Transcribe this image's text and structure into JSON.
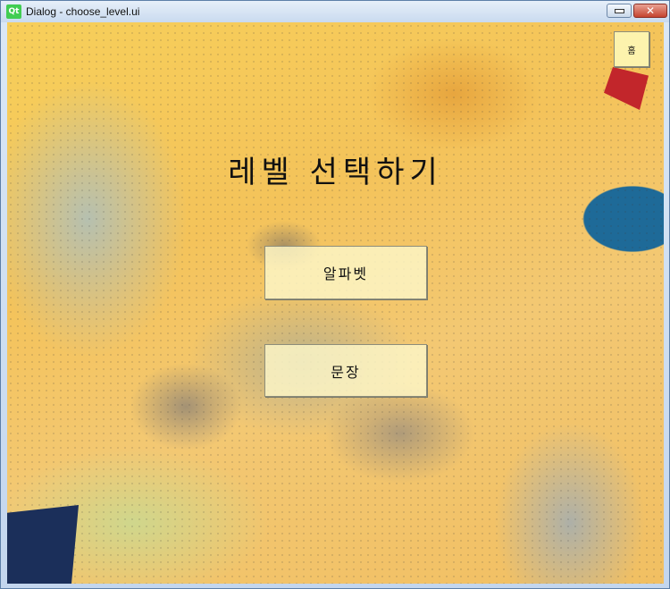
{
  "window": {
    "app_icon": "Qt",
    "title": "Dialog - choose_level.ui",
    "close_label": "✕"
  },
  "main": {
    "heading": "레벨 선택하기",
    "alphabet_button": "알파벳",
    "sentence_button": "문장",
    "home_button": "홈"
  }
}
